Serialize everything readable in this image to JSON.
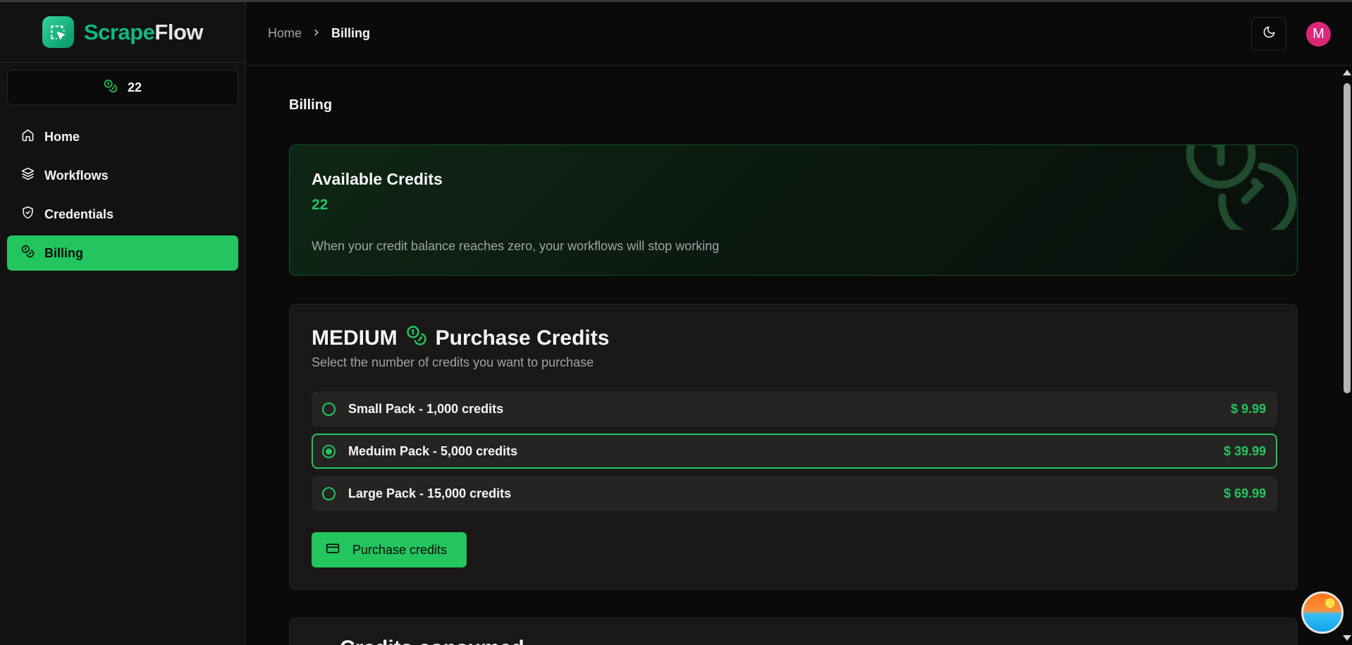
{
  "app": {
    "name_part1": "Scrape",
    "name_part2": "Flow"
  },
  "sidebar": {
    "credits": "22",
    "items": [
      {
        "label": "Home",
        "icon": "home-icon",
        "active": false
      },
      {
        "label": "Workflows",
        "icon": "layers-icon",
        "active": false
      },
      {
        "label": "Credentials",
        "icon": "shield-check-icon",
        "active": false
      },
      {
        "label": "Billing",
        "icon": "coins-icon",
        "active": true
      }
    ]
  },
  "header": {
    "breadcrumb": [
      "Home",
      "Billing"
    ],
    "avatar_initial": "M",
    "theme_icon": "moon-icon"
  },
  "main": {
    "page_title": "Billing",
    "available": {
      "title": "Available Credits",
      "value": "22",
      "description": "When your credit balance reaches zero, your workflows will stop working"
    },
    "purchase": {
      "prefix": "MEDIUM",
      "title": "Purchase Credits",
      "subtitle": "Select the number of credits you want to purchase",
      "options": [
        {
          "label": "Small Pack - 1,000 credits",
          "price": "$ 9.99",
          "selected": false
        },
        {
          "label": "Meduim Pack - 5,000 credits",
          "price": "$ 39.99",
          "selected": true
        },
        {
          "label": "Large Pack - 15,000 credits",
          "price": "$ 69.99",
          "selected": false
        }
      ],
      "button_label": "Purchase credits"
    },
    "next_section_title": "Credits consumed"
  },
  "colors": {
    "accent": "#22c55e",
    "brand": "#10b981",
    "avatar": "#db2777"
  }
}
